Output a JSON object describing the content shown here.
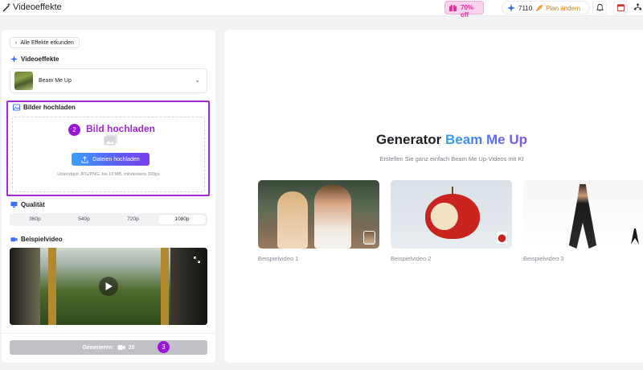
{
  "header": {
    "app_title": "Videoeffekte",
    "promo_label": "70% off",
    "credits": "7110",
    "plan_label": "Plan ändern",
    "icons": [
      "magic-wand-icon",
      "gift-icon",
      "sparkle-icon",
      "rocket-icon",
      "bell-icon",
      "calendar-icon",
      "network-icon"
    ]
  },
  "left": {
    "back_label": "Alle Effekte erkunden",
    "effects_section": "Videoeffekte",
    "selected_effect": "Beam Me Up",
    "upload_section": "Bilder hochladen",
    "step2": "2",
    "upload_title": "Bild hochladen",
    "upload_button": "Dateien hochladen",
    "upload_hint": "Unterstützt JPG/PNG, bis 10 MB, mindestens 300px",
    "quality_section": "Qualität",
    "quality_options": [
      "360p",
      "540p",
      "720p",
      "1080p"
    ],
    "quality_selected": "1080p",
    "sample_section": "Beispielvideo",
    "generate_label": "Generieren:",
    "generate_cost": "20",
    "step3": "3"
  },
  "right": {
    "heading_prefix": "Generator",
    "heading_accent": "Beam Me Up",
    "subheading": "Erstellen Sie ganz einfach Beam Me Up-Videos mit KI",
    "samples": [
      {
        "caption": "Beispielvideo 1"
      },
      {
        "caption": "Beispielvideo 2"
      },
      {
        "caption": "Beispielvideo 3"
      }
    ]
  },
  "colors": {
    "accent_purple": "#a12ad6",
    "gradient_blue": "#3aa0ff",
    "gradient_violet": "#7a3df0",
    "promo_pink": "#e0309b",
    "plan_orange": "#e47f00"
  }
}
